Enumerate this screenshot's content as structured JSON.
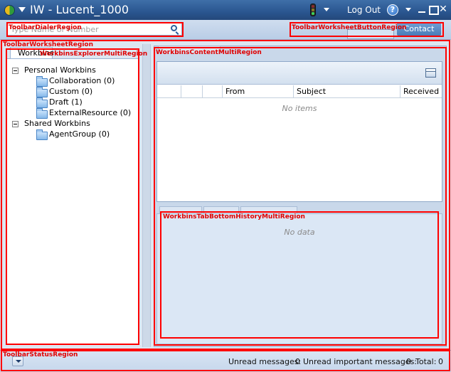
{
  "titlebar": {
    "title": "IW - Lucent_1000",
    "logout_label": "Log Out",
    "help_label": "?"
  },
  "toolbar": {
    "dialer_placeholder": "Type Name or Number",
    "contact_label": "Contact"
  },
  "explorer": {
    "tab_label": "Workbins",
    "groups": [
      {
        "label": "Personal Workbins",
        "items": [
          "Collaboration (0)",
          "Custom (0)",
          "Draft (1)",
          "ExternalResource (0)"
        ]
      },
      {
        "label": "Shared Workbins",
        "items": [
          "AgentGroup (0)"
        ]
      }
    ]
  },
  "content": {
    "columns": [
      "From",
      "Subject",
      "Received"
    ],
    "empty_text": "No items"
  },
  "history": {
    "empty_text": "No data"
  },
  "status": {
    "unread_label": "Unread messages:",
    "unread_value": "0",
    "unread_important_label": "Unread important messages:",
    "unread_important_value": "0",
    "total_label": "Total:",
    "total_value": "0"
  },
  "regions": {
    "dialer": "ToolbarDialerRegion",
    "worksheet_button": "ToolbarWorksheetButtonRegion",
    "worksheet": "ToolbarWorksheetRegion",
    "explorer": "WorkbinsExplorerMultiRegion",
    "content": "WorkbinsContentMultiRegion",
    "history": "WorkbinsTabBottomHistoryMultiRegion",
    "status": "ToolbarStatusRegion"
  },
  "colors": {
    "title_bar": "#2a5690",
    "region_outline": "#ff0000",
    "panel_bg": "#dce6f1"
  }
}
